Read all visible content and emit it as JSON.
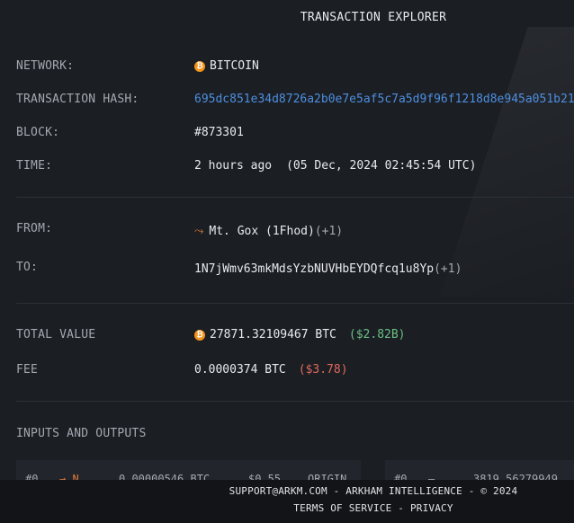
{
  "header": {
    "title": "TRANSACTION EXPLORER"
  },
  "details": {
    "network": {
      "label": "NETWORK:",
      "value": "BITCOIN",
      "icon": "bitcoin-icon"
    },
    "hash": {
      "label": "TRANSACTION HASH:",
      "value": "695dc851e34d8726a2b0e7e5af5c7a5d9f96f1218d8e945a051b21"
    },
    "block": {
      "label": "BLOCK:",
      "value": "#873301"
    },
    "time": {
      "label": "TIME:",
      "relative": "2 hours ago",
      "absolute": "(05 Dec, 2024 02:45:54 UTC)"
    },
    "from": {
      "label": "FROM:",
      "entity": "Mt. Gox (1Fhod)",
      "extra": "(+1)",
      "icon": "arrow-icon"
    },
    "to": {
      "label": "TO:",
      "address": "1N7jWmv63mkMdsYzbNUVHbEYDQfcq1u8Yp",
      "extra": "(+1)"
    },
    "total_value": {
      "label": "TOTAL VALUE",
      "amount": "27871.32109467 BTC",
      "usd": "($2.82B)",
      "icon": "bitcoin-icon"
    },
    "fee": {
      "label": "FEE",
      "amount": "0.0000374 BTC",
      "usd": "($3.78)"
    }
  },
  "io": {
    "label": "INPUTS AND OUTPUTS",
    "left_card": {
      "index": "#0",
      "icon": "chevron-icon",
      "amount": "0.00000546 BTC",
      "usd": "$0.55",
      "tag": "ORIGIN"
    },
    "right_card": {
      "index": "#0",
      "amount": "3819.56279949"
    }
  },
  "footer": {
    "line1": "SUPPORT@ARKM.COM - ARKHAM INTELLIGENCE - © 2024",
    "terms": "TERMS OF SERVICE",
    "sep": " - ",
    "privacy": "PRIVACY"
  },
  "colors": {
    "background": "#1b1e23",
    "link": "#4d8fe0",
    "positive": "#6bbf86",
    "negative": "#e06a5c",
    "bitcoin": "#f7931a"
  }
}
